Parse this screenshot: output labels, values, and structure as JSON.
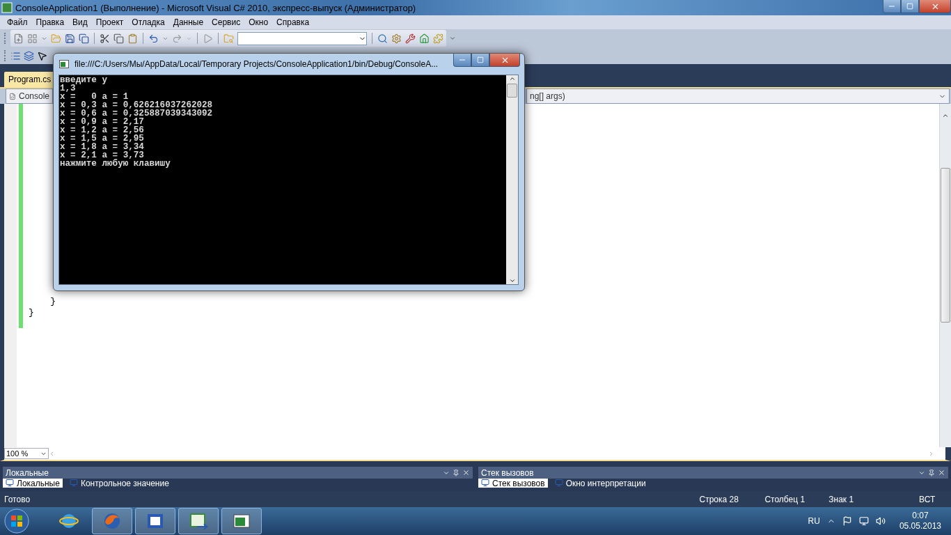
{
  "window": {
    "title": "ConsoleApplication1 (Выполнение) - Microsoft Visual C# 2010, экспресс-выпуск (Администратор)"
  },
  "menu": [
    "Файл",
    "Правка",
    "Вид",
    "Проект",
    "Отладка",
    "Данные",
    "Сервис",
    "Окно",
    "Справка"
  ],
  "tabs": [
    {
      "label": "Program.cs",
      "selected": true
    }
  ],
  "nav": {
    "left": "Console",
    "right": "ng[] args)"
  },
  "code_lines": [
    "    }",
    "}"
  ],
  "zoom": "100 %",
  "console": {
    "title": "file:///C:/Users/Мы/AppData/Local/Temporary Projects/ConsoleApplication1/bin/Debug/ConsoleA...",
    "lines": [
      "введите y",
      "1,3",
      "x =   0 a = 1",
      "x = 0,3 a = 0,626216037262028",
      "x = 0,6 a = 0,325887039343092",
      "x = 0,9 a = 2,17",
      "x = 1,2 a = 2,56",
      "x = 1,5 a = 2,95",
      "x = 1,8 a = 3,34",
      "x = 2,1 a = 3,73",
      "нажмите любую клавишу"
    ]
  },
  "panels": [
    {
      "title": "Локальные",
      "tabs": [
        {
          "label": "Локальные",
          "selected": true
        },
        {
          "label": "Контрольное значение",
          "selected": false
        }
      ]
    },
    {
      "title": "Стек вызовов",
      "tabs": [
        {
          "label": "Стек вызовов",
          "selected": true
        },
        {
          "label": "Окно интерпретации",
          "selected": false
        }
      ]
    }
  ],
  "status_bar": {
    "message": "Готово",
    "fields": [
      "Строка 28",
      "Столбец 1",
      "Знак 1",
      "ВСТ"
    ]
  },
  "taskbar": {
    "language": "RU",
    "time": "0:07",
    "date": "05.05.2013"
  }
}
